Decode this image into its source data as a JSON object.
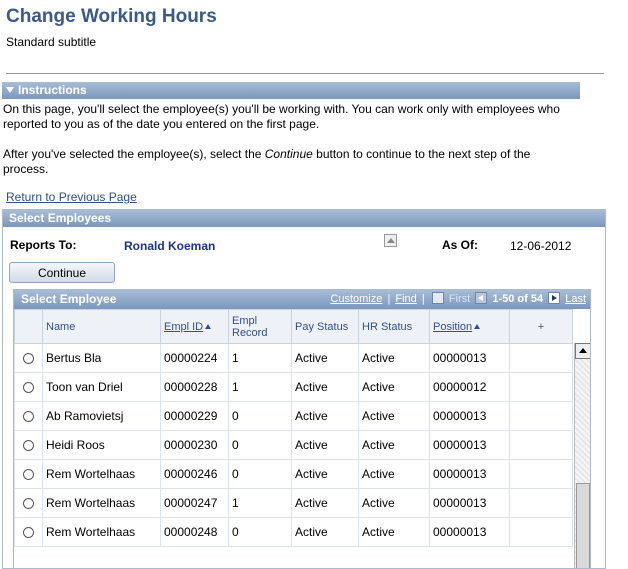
{
  "page": {
    "title": "Change Working Hours",
    "subtitle": "Standard subtitle"
  },
  "instructions": {
    "header": "Instructions",
    "p1": "On this page, you'll select the employee(s) you'll be working with. You can work only with employees who reported to you as of the date you entered on the first page.",
    "p2_before": "After you've selected the employee(s), select the ",
    "p2_em": "Continue",
    "p2_after": " button to continue to the next step of the process."
  },
  "return_link": "Return to Previous Page",
  "select_employees": {
    "header": "Select Employees",
    "reports_to_label": "Reports To:",
    "reports_to_value": "Ronald Koeman",
    "as_of_label": "As Of:",
    "as_of_value": "12-06-2012",
    "continue_label": "Continue"
  },
  "grid": {
    "title": "Select Employee",
    "nav": {
      "customize": "Customize",
      "find": "Find",
      "first": "First",
      "range": "1-50 of 54",
      "last": "Last"
    },
    "columns": [
      {
        "key": "name",
        "label": "Name"
      },
      {
        "key": "empl_id",
        "label": "Empl ID"
      },
      {
        "key": "empl_record",
        "label": "Empl Record"
      },
      {
        "key": "pay_status",
        "label": "Pay Status"
      },
      {
        "key": "hr_status",
        "label": "HR Status"
      },
      {
        "key": "position",
        "label": "Position"
      },
      {
        "key": "add",
        "label": "+"
      }
    ],
    "rows": [
      {
        "name": "Bertus Bla",
        "empl_id": "00000224",
        "empl_record": "1",
        "pay_status": "Active",
        "hr_status": "Active",
        "position": "00000013"
      },
      {
        "name": "Toon van Driel",
        "empl_id": "00000228",
        "empl_record": "1",
        "pay_status": "Active",
        "hr_status": "Active",
        "position": "00000012"
      },
      {
        "name": "Ab Ramovietsj",
        "empl_id": "00000229",
        "empl_record": "0",
        "pay_status": "Active",
        "hr_status": "Active",
        "position": "00000013"
      },
      {
        "name": "Heidi Roos",
        "empl_id": "00000230",
        "empl_record": "0",
        "pay_status": "Active",
        "hr_status": "Active",
        "position": "00000013"
      },
      {
        "name": "Rem Wortelhaas",
        "empl_id": "00000246",
        "empl_record": "0",
        "pay_status": "Active",
        "hr_status": "Active",
        "position": "00000013"
      },
      {
        "name": "Rem Wortelhaas",
        "empl_id": "00000247",
        "empl_record": "1",
        "pay_status": "Active",
        "hr_status": "Active",
        "position": "00000013"
      },
      {
        "name": "Rem Wortelhaas",
        "empl_id": "00000248",
        "empl_record": "0",
        "pay_status": "Active",
        "hr_status": "Active",
        "position": "00000013"
      }
    ]
  }
}
